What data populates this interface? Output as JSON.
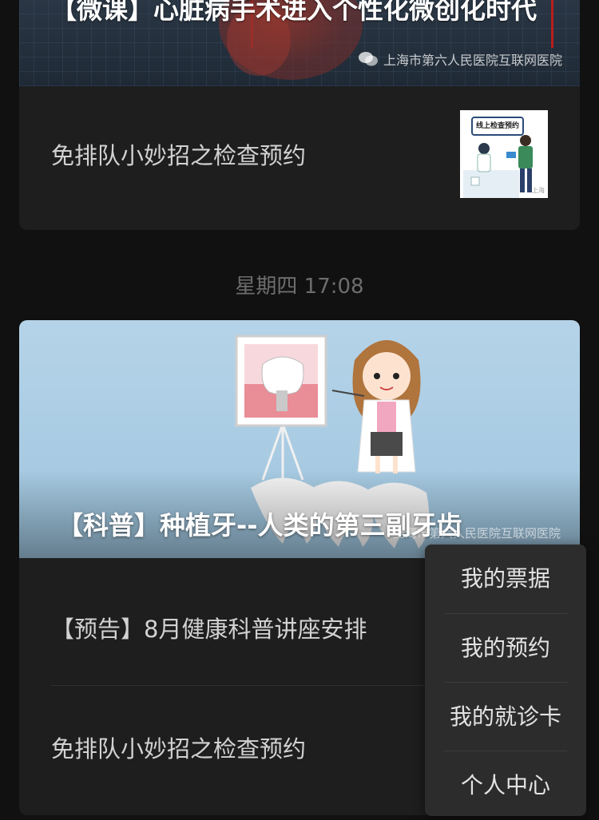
{
  "article1": {
    "title": "【微课】心脏病手术进入个性化微创化时代",
    "source": "上海市第六人民医院互联网医院",
    "item_text": "免排队小妙招之检查预约",
    "thumb_banner": "线上检查预约",
    "thumb_watermark": "上海"
  },
  "timestamp": "星期四 17:08",
  "article2": {
    "title": "【科普】种植牙--人类的第三副牙齿",
    "source": "上海市第六人民医院互联网医院",
    "items": [
      {
        "text": "【预告】8月健康科普讲座安排"
      },
      {
        "text": "免排队小妙招之检查预约"
      }
    ]
  },
  "menu": {
    "items": [
      {
        "label": "我的票据"
      },
      {
        "label": "我的预约"
      },
      {
        "label": "我的就诊卡"
      },
      {
        "label": "个人中心"
      }
    ]
  },
  "icons": {
    "wechat": "wechat-icon"
  }
}
